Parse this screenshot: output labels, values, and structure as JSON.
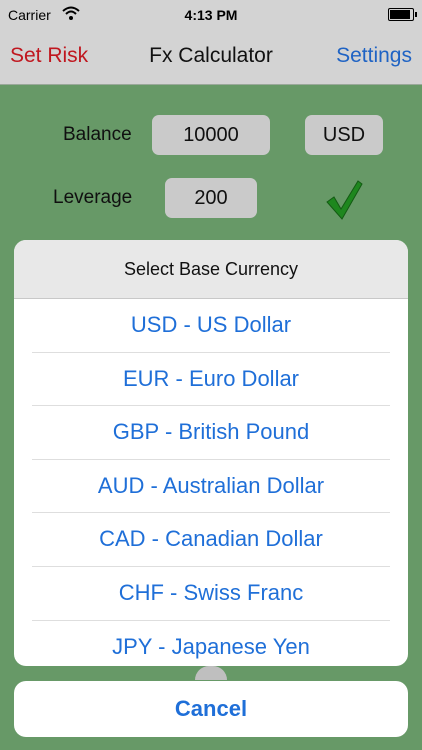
{
  "status_bar": {
    "carrier": "Carrier",
    "time": "4:13 PM"
  },
  "nav": {
    "left_label": "Set Risk",
    "title": "Fx Calculator",
    "right_label": "Settings"
  },
  "form": {
    "balance_label": "Balance",
    "balance_value": "10000",
    "currency_value": "USD",
    "leverage_label": "Leverage",
    "leverage_value": "200"
  },
  "action_sheet": {
    "title": "Select Base Currency",
    "options": [
      "USD - US Dollar",
      "EUR - Euro Dollar",
      "GBP - British Pound",
      "AUD - Australian Dollar",
      "CAD - Canadian Dollar",
      "CHF - Swiss Franc",
      "JPY - Japanese Yen"
    ],
    "cancel_label": "Cancel"
  },
  "colors": {
    "background": "#6a9d6a",
    "nav_left": "#c0171f",
    "nav_right": "#1f63c4",
    "option_text": "#1f6fd8",
    "check": "#1f8a1f"
  },
  "icons": [
    "wifi-icon",
    "battery-icon",
    "checkmark-icon"
  ]
}
